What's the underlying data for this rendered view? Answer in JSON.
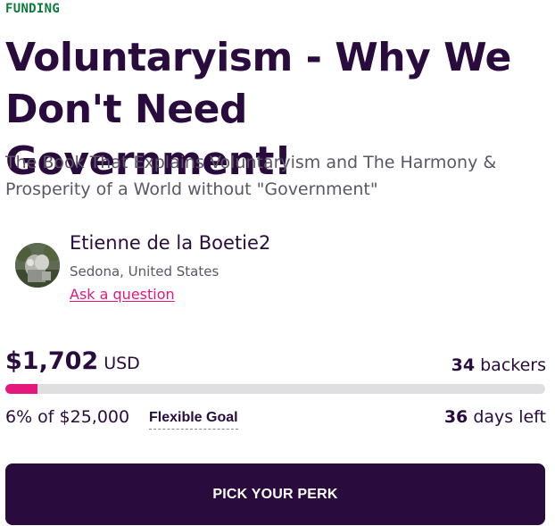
{
  "campaign": {
    "status_label": "FUNDING",
    "title": "Voluntaryism - Why We Don't Need Government!",
    "subtitle": "The Book That Explains Voluntaryism and The Harmony & Prosperity of a World without \"Government\""
  },
  "owner": {
    "name": "Etienne de la Boetie2",
    "location": "Sedona, United States",
    "ask_link": "Ask a question",
    "avatar_icon": "user-avatar-photo"
  },
  "funding": {
    "raised_amount": "$1,702",
    "currency": "USD",
    "backers_count": "34",
    "backers_label": "backers",
    "progress_percent": 6,
    "percent_text": "6% of $25,000",
    "goal_type": "Flexible Goal",
    "days_left_count": "36",
    "days_left_label": "days left"
  },
  "actions": {
    "cta_label": "PICK YOUR PERK"
  },
  "colors": {
    "accent": "#e5177e",
    "brand_dark": "#2a0b3d",
    "status_green": "#0b7a3b",
    "progress_track": "#dfdfe1",
    "muted_text": "#5c5566"
  }
}
